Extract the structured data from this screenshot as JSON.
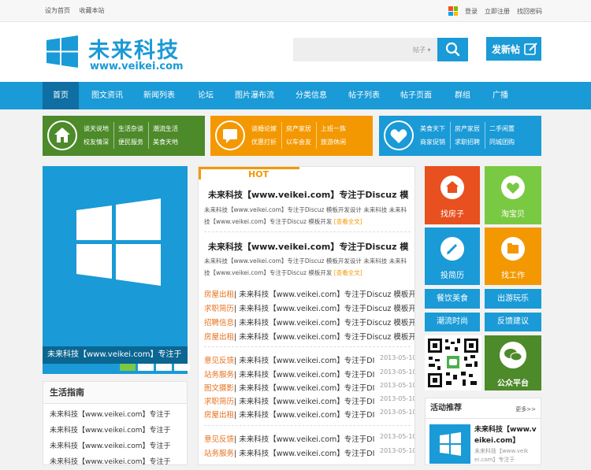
{
  "topbar": {
    "left": [
      "设为首页",
      "收藏本站"
    ],
    "right": [
      "登录",
      "立即注册",
      "找回密码"
    ],
    "colors": [
      "#f25022",
      "#7fba00",
      "#00a4ef",
      "#ffb900"
    ]
  },
  "header": {
    "logo_title": "未来科技",
    "logo_sub": "www.veikei.com",
    "search_type": "帖子 ▾",
    "post_button": "发新帖"
  },
  "nav": [
    "首页",
    "图文资讯",
    "新闻列表",
    "论坛",
    "图片瀑布流",
    "分类信息",
    "帖子列表",
    "帖子页面",
    "群组",
    "广播"
  ],
  "categories": [
    {
      "color": "#4d8a2a",
      "icon": "house-icon",
      "rows": [
        [
          "谈天说地",
          "生活杂谈",
          "潮流生活"
        ],
        [
          "校友情深",
          "便民服务",
          "美食天地"
        ]
      ]
    },
    {
      "color": "#f39800",
      "icon": "chat-bubble-icon",
      "rows": [
        [
          "谈婚论嫁",
          "房产家居",
          "上班一族"
        ],
        [
          "优惠打折",
          "以车会友",
          "旅游休闲"
        ]
      ]
    },
    {
      "color": "#1a9ad6",
      "icon": "heart-icon",
      "rows": [
        [
          "美食天下",
          "房产家居",
          "二手闲置"
        ],
        [
          "商家促销",
          "求职招聘",
          "同城团购"
        ]
      ]
    }
  ],
  "banner": {
    "caption": "未来科技【www.veikei.com】专注于",
    "dots": 4
  },
  "life": {
    "title": "生活指南",
    "items": [
      "未来科技【www.veikei.com】专注于",
      "未来科技【www.veikei.com】专注于",
      "未来科技【www.veikei.com】专注于",
      "未来科技【www.veikei.com】专注于"
    ]
  },
  "hot": {
    "label": "HOT",
    "headlines": [
      {
        "title": "未来科技【www.veikei.com】专注于Discuz 模",
        "desc1": "未来科技【www.veikei.com】专注于Discuz 模板开发设计 未来科技 未来科",
        "desc2": "技【www.veikei.com】专注于Discuz 模板开发",
        "more": "[查看全文]"
      },
      {
        "title": "未来科技【www.veikei.com】专注于Discuz 模",
        "desc1": "未来科技【www.veikei.com】专注于Discuz 模板开发设计 未来科技 未来科",
        "desc2": "技【www.veikei.com】专注于Discuz 模板开发",
        "more": "[查看全文]"
      }
    ],
    "tag_list": [
      {
        "tag": "房屋出租",
        "text": "| 未来科技【www.veikei.com】专注于Discuz 模板开发"
      },
      {
        "tag": "求职简历",
        "text": "| 未来科技【www.veikei.com】专注于Discuz 模板开发"
      },
      {
        "tag": "招聘信息",
        "text": "| 未来科技【www.veikei.com】专注于Discuz 模板开发"
      },
      {
        "tag": "房屋出租",
        "text": "| 未来科技【www.veikei.com】专注于Discuz 模板开发"
      }
    ],
    "dated_list_1": [
      {
        "tag": "意见反馈",
        "text": "| 未来科技【www.veikei.com】专注于DI",
        "date": "2013-05-10"
      },
      {
        "tag": "站务服务",
        "text": "| 未来科技【www.veikei.com】专注于DI",
        "date": "2013-05-10"
      },
      {
        "tag": "图文摄影",
        "text": "| 未来科技【www.veikei.com】专注于DI",
        "date": "2013-05-10"
      },
      {
        "tag": "求职简历",
        "text": "| 未来科技【www.veikei.com】专注于DI",
        "date": "2013-05-10"
      },
      {
        "tag": "房屋出租",
        "text": "| 未来科技【www.veikei.com】专注于DI",
        "date": "2013-05-10"
      }
    ],
    "dated_list_2": [
      {
        "tag": "意见反馈",
        "text": "| 未来科技【www.veikei.com】专注于DI",
        "date": "2013-05-10"
      },
      {
        "tag": "站务服务",
        "text": "| 未来科技【www.veikei.com】专注于DI",
        "date": "2013-05-10"
      }
    ]
  },
  "tiles": {
    "find_house": "找房子",
    "taobao": "淘宝贝",
    "resume": "投简历",
    "find_job": "找工作",
    "food": "餐饮美食",
    "travel": "出游玩乐",
    "trend": "潮流时尚",
    "feedback": "反馈建议",
    "public": "公众平台"
  },
  "activity": {
    "title": "活动推荐",
    "more": "更多>>",
    "item_title_1": "未来科技【www.v",
    "item_title_2": "eikei.com】",
    "item_desc_1": "未来科技【www.veik",
    "item_desc_2": "ei.com】专注于"
  }
}
